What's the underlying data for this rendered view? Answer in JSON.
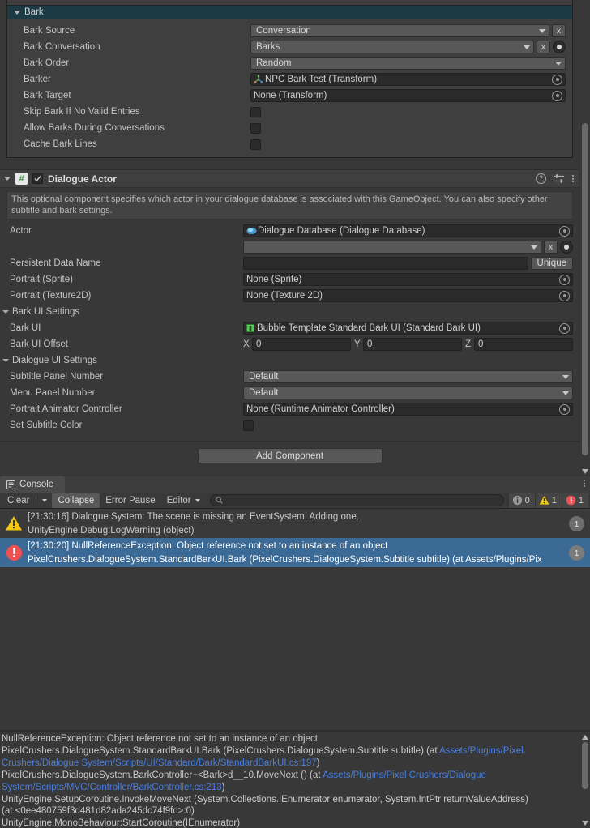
{
  "inspector": {
    "bark_section": {
      "header": "Bark",
      "rows": [
        {
          "label": "Bark Source",
          "type": "popup",
          "value": "Conversation",
          "has_x": true
        },
        {
          "label": "Bark Conversation",
          "type": "popup",
          "value": "Barks",
          "has_x": true,
          "has_dot": true
        },
        {
          "label": "Bark Order",
          "type": "popup",
          "value": "Random"
        },
        {
          "label": "Barker",
          "type": "object",
          "value": "NPC Bark Test (Transform)",
          "icon": "transform-icon"
        },
        {
          "label": "Bark Target",
          "type": "object",
          "value": "None (Transform)"
        },
        {
          "label": "Skip Bark If No Valid Entries",
          "type": "checkbox",
          "checked": false
        },
        {
          "label": "Allow Barks During Conversations",
          "type": "checkbox",
          "checked": false
        },
        {
          "label": "Cache Bark Lines",
          "type": "checkbox",
          "checked": false
        }
      ]
    },
    "dialogue_actor": {
      "title": "Dialogue Actor",
      "enabled": true,
      "icon": "script-component-icon",
      "help_icon": "help-icon",
      "preset_icon": "preset-settings-icon",
      "menu_icon": "kebab-menu-icon",
      "help_text": "This optional component specifies which actor in your dialogue database is associated with this GameObject. You can also specify other subtitle and bark settings.",
      "actor_label": "Actor",
      "actor_value": "Dialogue Database (Dialogue Database)",
      "actor_dropdown_value": "",
      "persistent_label": "Persistent Data Name",
      "persistent_value": "",
      "unique_button": "Unique",
      "portrait_sprite_label": "Portrait (Sprite)",
      "portrait_sprite_value": "None (Sprite)",
      "portrait_tex_label": "Portrait (Texture2D)",
      "portrait_tex_value": "None (Texture 2D)",
      "bark_ui_settings_label": "Bark UI Settings",
      "bark_ui_label": "Bark UI",
      "bark_ui_value": "Bubble Template Standard Bark UI (Standard Bark UI)",
      "bark_ui_offset_label": "Bark UI Offset",
      "offset": {
        "x_axis": "X",
        "x": "0",
        "y_axis": "Y",
        "y": "0",
        "z_axis": "Z",
        "z": "0"
      },
      "dialogue_ui_settings_label": "Dialogue UI Settings",
      "subtitle_panel_label": "Subtitle Panel Number",
      "subtitle_panel_value": "Default",
      "menu_panel_label": "Menu Panel Number",
      "menu_panel_value": "Default",
      "portrait_anim_label": "Portrait Animator Controller",
      "portrait_anim_value": "None (Runtime Animator Controller)",
      "set_subtitle_color_label": "Set Subtitle Color",
      "set_subtitle_color_checked": false
    },
    "add_component": "Add Component"
  },
  "console": {
    "tab_label": "Console",
    "tab_icon": "console-icon",
    "menu_icon": "kebab-menu-icon",
    "toolbar": {
      "clear": "Clear",
      "clear_dropdown_icon": "chevron-down-icon",
      "collapse": "Collapse",
      "collapse_active": true,
      "error_pause": "Error Pause",
      "editor": "Editor",
      "editor_caret_icon": "chevron-down-icon",
      "search_placeholder": "",
      "search_icon": "search-icon",
      "info_count": "0",
      "warning_count": "1",
      "error_count": "1"
    },
    "messages": [
      {
        "type": "warning",
        "icon": "warning-icon",
        "line1": "[21:30:16] Dialogue System: The scene is missing an EventSystem. Adding one.",
        "line2": "UnityEngine.Debug:LogWarning (object)",
        "count": "1",
        "selected": false
      },
      {
        "type": "error",
        "icon": "error-icon",
        "line1": "[21:30:20] NullReferenceException: Object reference not set to an instance of an object",
        "line2": "PixelCrushers.DialogueSystem.StandardBarkUI.Bark (PixelCrushers.DialogueSystem.Subtitle subtitle) (at Assets/Plugins/Pix",
        "count": "1",
        "selected": true
      }
    ],
    "detail": {
      "lines": [
        [
          {
            "t": "NullReferenceException: Object reference not set to an instance of an object",
            "link": false
          }
        ],
        [
          {
            "t": "PixelCrushers.DialogueSystem.StandardBarkUI.Bark (PixelCrushers.DialogueSystem.Subtitle subtitle) (at ",
            "link": false
          },
          {
            "t": "Assets/Plugins/Pixel",
            "link": true
          }
        ],
        [
          {
            "t": "Crushers/Dialogue System/Scripts/UI/Standard/Bark/StandardBarkUI.cs:197",
            "link": true
          },
          {
            "t": ")",
            "link": false
          }
        ],
        [
          {
            "t": "PixelCrushers.DialogueSystem.BarkController+<Bark>d__10.MoveNext () (at ",
            "link": false
          },
          {
            "t": "Assets/Plugins/Pixel Crushers/Dialogue",
            "link": true
          }
        ],
        [
          {
            "t": "System/Scripts/MVC/Controller/BarkController.cs:213",
            "link": true
          },
          {
            "t": ")",
            "link": false
          }
        ],
        [
          {
            "t": "UnityEngine.SetupCoroutine.InvokeMoveNext (System.Collections.IEnumerator enumerator, System.IntPtr returnValueAddress)",
            "link": false
          }
        ],
        [
          {
            "t": "(at <0ee480759f3d481d82ada245dc74f9fd>:0)",
            "link": false
          }
        ],
        [
          {
            "t": "UnityEngine.MonoBehaviour:StartCoroutine(IEnumerator)",
            "link": false
          }
        ]
      ]
    }
  },
  "colors": {
    "bg": "#383838",
    "panel": "#3f3f3f",
    "foldout_header": "#1c3a43",
    "selection_blue": "#3a6a95",
    "warning_yellow": "#f2c811",
    "error_red": "#f05050",
    "link_blue": "#4a7ede"
  }
}
